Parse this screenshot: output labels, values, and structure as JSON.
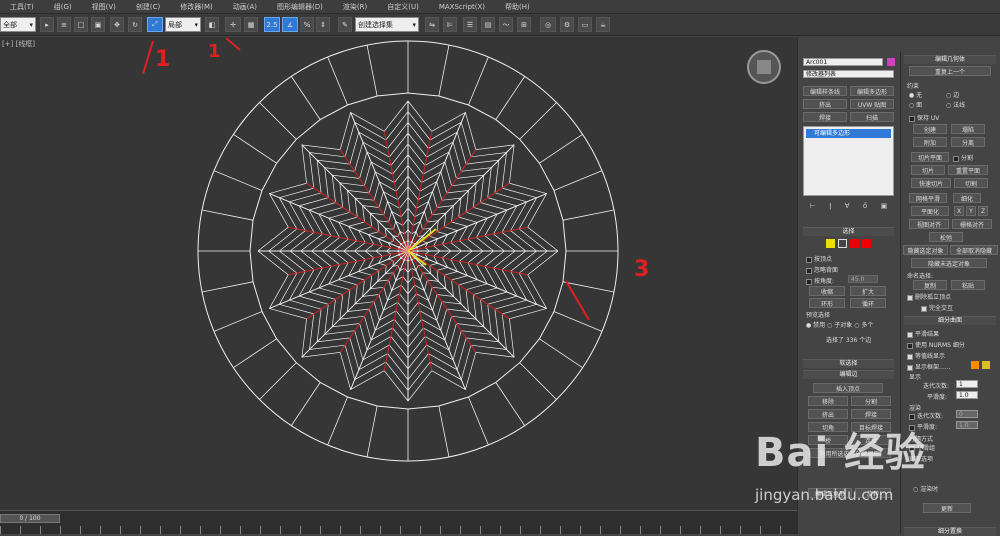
{
  "menu": [
    "工具(T)",
    "组(G)",
    "视图(V)",
    "创建(C)",
    "修改器(M)",
    "动画(A)",
    "图形编辑器(D)",
    "渲染(R)",
    "自定义(U)",
    "MAXScript(X)",
    "帮助(H)"
  ],
  "toolbar": {
    "filter_value": "全部",
    "coord_value": "局部",
    "selset_value": "创建选择集"
  },
  "viewport": {
    "label": "[+] [线框]",
    "annot1": "1",
    "annot2": "1",
    "annot3": "3"
  },
  "timeline": {
    "frame": "0 / 100"
  },
  "cmd": {
    "object_name": "Arc001",
    "modifier_list": "修改器列表",
    "btn_edit_poly_sel": "编辑样条线",
    "btn_edit_poly": "编辑多边形",
    "btn_extrude": "挤出",
    "btn_uvw": "UVW 贴图",
    "btn_weld": "焊接",
    "btn_sweep": "扫描",
    "stack_item": "可编辑多边形",
    "sel_header": "选择",
    "by_vertex": "按顶点",
    "ignore_back": "忽略背面",
    "by_angle": "按角度:",
    "angle_val": "45.0",
    "shrink": "收缩",
    "grow": "扩大",
    "ring": "环形",
    "loop": "循环",
    "preview": "预览选择",
    "disabled": "禁用",
    "subobj": "子对象",
    "multi": "多个",
    "sel_count": "选择了 336 个边",
    "soft_sel": "软选择",
    "edit_edge": "编辑边",
    "insert_vertex": "插入顶点",
    "remove": "移除",
    "split": "分割",
    "extrude2": "挤出",
    "weld2": "焊接",
    "chamfer": "切角",
    "target_weld": "目标焊接",
    "bridge": "桥",
    "connect": "连接",
    "create_shape": "利用所选内容创建图形",
    "edit_tri": "编辑三角形",
    "rotate": "旋转"
  },
  "cmd2": {
    "edit_geo": "编辑几何体",
    "repeat_last": "重复上一个",
    "constraints": "约束",
    "c_none": "无",
    "c_edge": "边",
    "c_face": "面",
    "c_normal": "法线",
    "keep_uv": "保持 UV",
    "create": "创建",
    "collapse": "塌陷",
    "attach": "附加",
    "detach": "分离",
    "slice_plane": "切片平面",
    "split": "分割",
    "slice": "切片",
    "reset_plane": "重置平面",
    "quickslice": "快速切片",
    "cut": "切割",
    "meshsmooth": "网格平滑",
    "tessellate": "细化",
    "make_planar": "平面化",
    "x": "X",
    "y": "Y",
    "z": "Z",
    "view_align": "视图对齐",
    "grid_align": "栅格对齐",
    "relax": "松弛",
    "hide_sel": "隐藏选定对象",
    "unhide_all": "全部取消隐藏",
    "hide_unsel": "隐藏未选定对象",
    "named_sel": "命名选择:",
    "copy": "复制",
    "paste": "粘贴",
    "delete_iso": "删除孤立顶点",
    "full_interact": "完全交互",
    "subdiv": "细分曲面",
    "smooth_result": "平滑结果",
    "use_nurms": "使用 NURMS 细分",
    "iso_display": "等值线显示",
    "show_cage": "显示框架......",
    "display": "显示",
    "iterations": "迭代次数:",
    "iter_val": "1",
    "smoothness": "平滑度:",
    "smooth_val": "1.0",
    "render": "渲染",
    "r_iter_val": "0",
    "r_smooth_val": "1.0",
    "sep_by": "分隔方式",
    "smoothing_groups": "平滑组",
    "update_opts": "更新选项",
    "render_time": "渲染时",
    "update": "更新",
    "subdiv_disp": "细分置换"
  },
  "watermark": {
    "brand": "Bai 经验",
    "url": "jingyan.baidu.com"
  },
  "colors": {
    "accent_blue": "#2f7ad7",
    "annot_red": "#e02020",
    "wire_white": "#f0f0f0",
    "wire_red": "#d02020",
    "swatch_orange": "#ff8a00",
    "swatch_yellow": "#d8c020",
    "obj_color": "#d040c0"
  }
}
